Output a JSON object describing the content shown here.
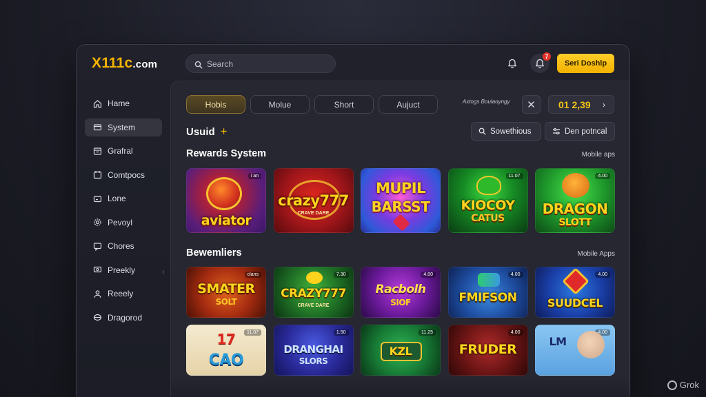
{
  "app": {
    "logo_main": "X111c",
    "logo_domain": ".com",
    "brand_color": "#f5b400"
  },
  "header": {
    "search_placeholder": "Search",
    "notification_count": "7",
    "cta_label": "Seri Doshlp"
  },
  "sidebar": {
    "items": [
      {
        "label": "Hame",
        "icon": "home-icon",
        "active": false
      },
      {
        "label": "System",
        "icon": "wallet-icon",
        "active": true
      },
      {
        "label": "Grafral",
        "icon": "grid-icon",
        "active": false
      },
      {
        "label": "Comtpocs",
        "icon": "calendar-icon",
        "active": false
      },
      {
        "label": "Lone",
        "icon": "card-icon",
        "active": false
      },
      {
        "label": "Pevoyl",
        "icon": "gear-icon",
        "active": false
      },
      {
        "label": "Chores",
        "icon": "chat-icon",
        "active": false
      },
      {
        "label": "Preekly",
        "icon": "monitor-icon",
        "active": false
      },
      {
        "label": "Reeely",
        "icon": "user-icon",
        "active": false
      },
      {
        "label": "Dragorod",
        "icon": "shield-icon",
        "active": false
      }
    ]
  },
  "toolbar": {
    "tabs": [
      {
        "label": "Hobis",
        "active": true
      },
      {
        "label": "Molue",
        "active": false
      },
      {
        "label": "Short",
        "active": false
      },
      {
        "label": "Aujuct",
        "active": false
      }
    ],
    "filter_label": "Axtogs Boulaoyngy",
    "balance": "01 2,39"
  },
  "subheader": {
    "title": "Usuid",
    "search_btn": "Sowethious",
    "filter_btn": "Den potncal"
  },
  "sections": [
    {
      "title": "Rewards System",
      "link": "Mobile  aps",
      "games": [
        {
          "title": "aviator",
          "sub": "",
          "tag": "i an"
        },
        {
          "title": "crazy777",
          "sub": "CRAVE DARE",
          "tag": ""
        },
        {
          "title": "MUPIL",
          "sub": "BARSST",
          "tag": ""
        },
        {
          "title": "KIOCOY",
          "sub": "CATUS",
          "tag": "11.07"
        },
        {
          "title": "DRAGON",
          "sub": "SLOTT",
          "tag": "4.00"
        }
      ]
    },
    {
      "title": "Bewemliers",
      "link": "Mobile Apps",
      "games": [
        {
          "title": "SMATER",
          "sub": "SOLT",
          "tag": "clans"
        },
        {
          "title": "CRAZY777",
          "sub": "CRAVE DARE",
          "tag": "7.30"
        },
        {
          "title": "Racbolh",
          "sub": "SIOF",
          "tag": "4.00"
        },
        {
          "title": "FMIFSON",
          "sub": "",
          "tag": "4.00"
        },
        {
          "title": "SUUDCEL",
          "sub": "",
          "tag": "4.00"
        }
      ]
    },
    {
      "title": "",
      "link": "",
      "games": [
        {
          "title": "17",
          "sub": "CAO",
          "tag": "11.07"
        },
        {
          "title": "DRANGHAI",
          "sub": "SLORS",
          "tag": "1.50"
        },
        {
          "title": "KZL",
          "sub": "",
          "tag": "11.25"
        },
        {
          "title": "FRUDER",
          "sub": "",
          "tag": "4.00"
        },
        {
          "title": "LM",
          "sub": "",
          "tag": "4.00"
        }
      ]
    }
  ],
  "watermark": "Grok"
}
